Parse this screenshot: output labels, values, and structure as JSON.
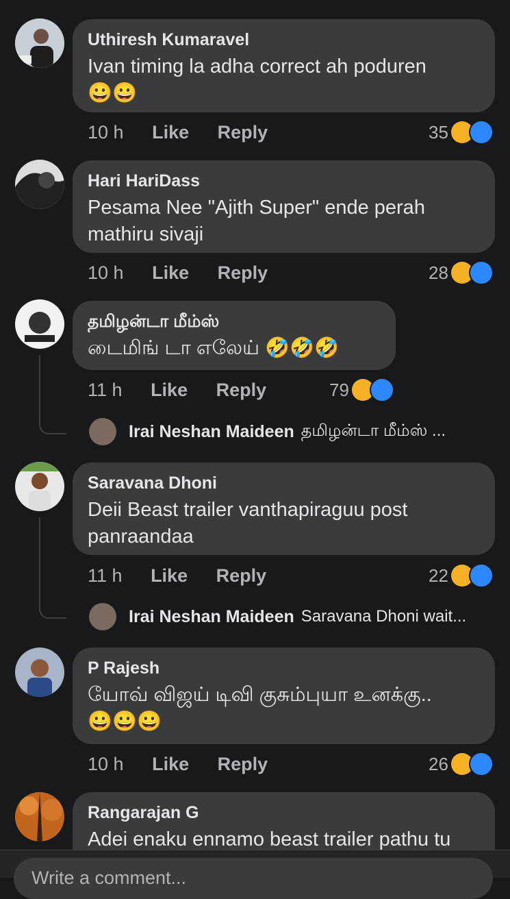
{
  "comments": [
    {
      "name": "Uthiresh Kumaravel",
      "text": "Ivan timing la adha correct ah poduren",
      "emoji": "😀😀",
      "time": "10 h",
      "like": "Like",
      "reply": "Reply",
      "count": "35"
    },
    {
      "name": "Hari HariDass",
      "text": "Pesama Nee \"Ajith Super\" ende perah mathiru sivaji",
      "time": "10 h",
      "like": "Like",
      "reply": "Reply",
      "count": "28"
    },
    {
      "name": "தமிழன்டா மீம்ஸ்",
      "text": "டைமிங் டா எலேய்",
      "emoji": "🤣🤣🤣",
      "time": "11 h",
      "like": "Like",
      "reply": "Reply",
      "count": "79",
      "reply_preview": {
        "name": "Irai Neshan Maideen",
        "text": "தமிழன்டா மீம்ஸ் ..."
      }
    },
    {
      "name": "Saravana Dhoni",
      "text": "Deii Beast trailer vanthapiraguu post panraandaa",
      "time": "11 h",
      "like": "Like",
      "reply": "Reply",
      "count": "22",
      "reply_preview": {
        "name": "Irai Neshan Maideen",
        "text": "Saravana Dhoni wait..."
      }
    },
    {
      "name": "P Rajesh",
      "text": "யோவ் விஜய் டிவி குசும்புயா உனக்கு..",
      "emoji": "😀😀😀",
      "time": "10 h",
      "like": "Like",
      "reply": "Reply",
      "count": "26"
    },
    {
      "name": "Rangarajan G",
      "text": "Adei enaku ennamo beast trailer pathu tu"
    }
  ],
  "composer": {
    "placeholder": "Write a comment..."
  },
  "colors": {
    "bg": "#18191a",
    "bubble": "#3a3b3c",
    "haha": "#f7b125",
    "like": "#2d88ff"
  }
}
